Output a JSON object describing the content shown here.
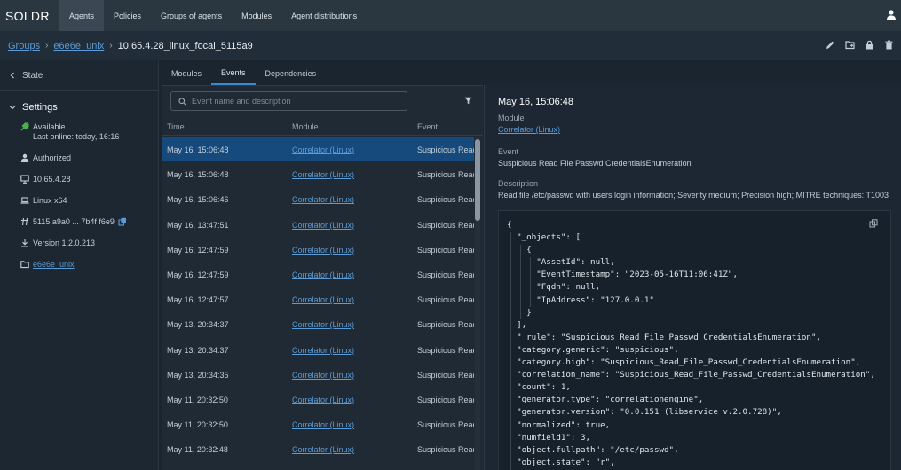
{
  "app": {
    "logo": "SOLDR"
  },
  "nav": [
    {
      "label": "Agents",
      "active": true
    },
    {
      "label": "Policies"
    },
    {
      "label": "Groups of agents"
    },
    {
      "label": "Modules"
    },
    {
      "label": "Agent distributions"
    }
  ],
  "breadcrumb": {
    "groups": "Groups",
    "group": "e6e6e_unix",
    "current": "10.65.4.28_linux_focal_5115a9"
  },
  "sidebar": {
    "state_label": "State",
    "settings_label": "Settings",
    "status_available": "Available",
    "last_online": "Last online: today, 16:16",
    "authorized": "Authorized",
    "ip": "10.65.4.28",
    "os": "Linux x64",
    "hash": "5115 a9a0 ... 7b4f f6e9",
    "version": "Version 1.2.0.213",
    "group_link": "e6e6e_unix"
  },
  "tabs": [
    {
      "label": "Modules"
    },
    {
      "label": "Events",
      "active": true
    },
    {
      "label": "Dependencies"
    }
  ],
  "events": {
    "search_placeholder": "Event name and description",
    "columns": {
      "time": "Time",
      "module": "Module",
      "event": "Event"
    },
    "rows": [
      {
        "time": "May 16, 15:06:48",
        "module": "Correlator (Linux)",
        "event": "Suspicious Read"
      },
      {
        "time": "May 16, 15:06:48",
        "module": "Correlator (Linux)",
        "event": "Suspicious Read"
      },
      {
        "time": "May 16, 15:06:46",
        "module": "Correlator (Linux)",
        "event": "Suspicious Read"
      },
      {
        "time": "May 16, 13:47:51",
        "module": "Correlator (Linux)",
        "event": "Suspicious Read"
      },
      {
        "time": "May 16, 12:47:59",
        "module": "Correlator (Linux)",
        "event": "Suspicious Read"
      },
      {
        "time": "May 16, 12:47:59",
        "module": "Correlator (Linux)",
        "event": "Suspicious Read"
      },
      {
        "time": "May 16, 12:47:57",
        "module": "Correlator (Linux)",
        "event": "Suspicious Read"
      },
      {
        "time": "May 13, 20:34:37",
        "module": "Correlator (Linux)",
        "event": "Suspicious Read"
      },
      {
        "time": "May 13, 20:34:37",
        "module": "Correlator (Linux)",
        "event": "Suspicious Read"
      },
      {
        "time": "May 13, 20:34:35",
        "module": "Correlator (Linux)",
        "event": "Suspicious Read"
      },
      {
        "time": "May 11, 20:32:50",
        "module": "Correlator (Linux)",
        "event": "Suspicious Read"
      },
      {
        "time": "May 11, 20:32:50",
        "module": "Correlator (Linux)",
        "event": "Suspicious Read"
      },
      {
        "time": "May 11, 20:32:48",
        "module": "Correlator (Linux)",
        "event": "Suspicious Read"
      }
    ]
  },
  "detail": {
    "title": "May 16, 15:06:48",
    "module_label": "Module",
    "module_value": "Correlator (Linux)",
    "event_label": "Event",
    "event_value": "Suspicious Read File Passwd CredentialsEnumeration",
    "description_label": "Description",
    "description_value": "Read file /etc/passwd with users login information; Severity medium; Precision high; MITRE techniques: T1003",
    "json_lines": [
      "{",
      "  \"_objects\": [",
      "    {",
      "      \"AssetId\": null,",
      "      \"EventTimestamp\": \"2023-05-16T11:06:41Z\",",
      "      \"Fqdn\": null,",
      "      \"IpAddress\": \"127.0.0.1\"",
      "    }",
      "  ],",
      "  \"_rule\": \"Suspicious_Read_File_Passwd_CredentialsEnumeration\",",
      "  \"category.generic\": \"suspicious\",",
      "  \"category.high\": \"Suspicious_Read_File_Passwd_CredentialsEnumeration\",",
      "  \"correlation_name\": \"Suspicious_Read_File_Passwd_CredentialsEnumeration\",",
      "  \"count\": 1,",
      "  \"generator.type\": \"correlationengine\",",
      "  \"generator.version\": \"0.0.151 (libservice v.2.0.728)\",",
      "  \"normalized\": true,",
      "  \"numfield1\": 3,",
      "  \"object.fullpath\": \"/etc/passwd\",",
      "  \"object.state\": \"r\","
    ]
  },
  "colors": {
    "accent": "#3a86d0",
    "link": "#5d9bd6",
    "selected_row": "#164a7c",
    "status_green": "#4caf50"
  }
}
